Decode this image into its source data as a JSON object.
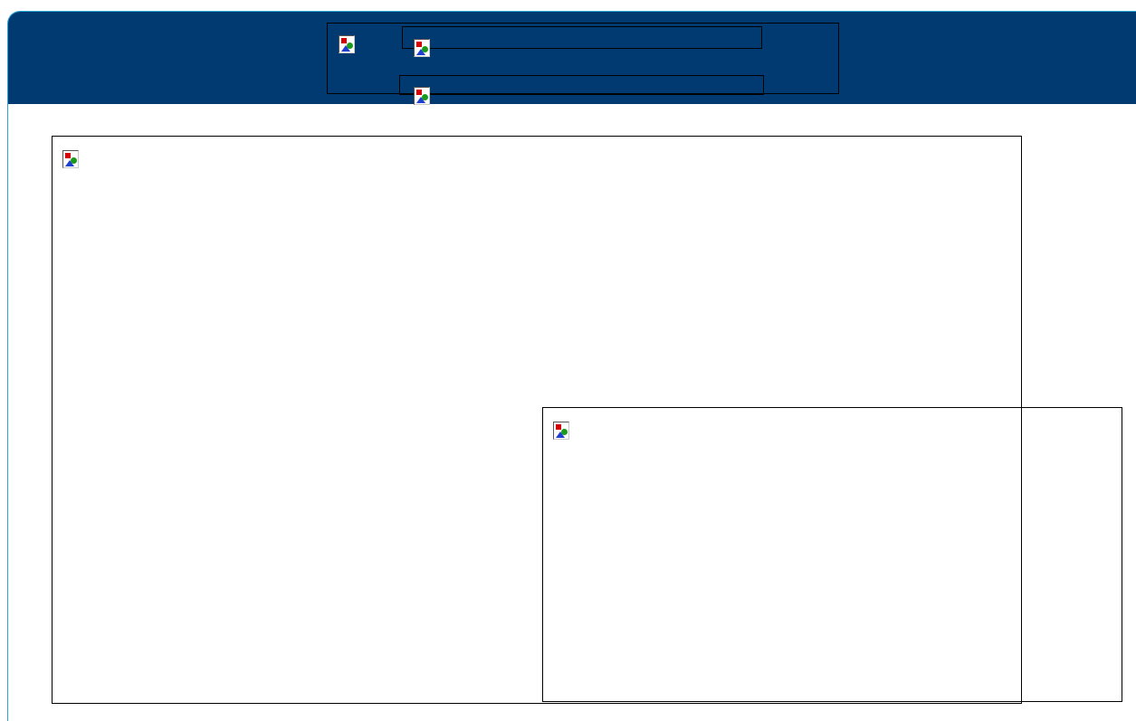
{
  "page": {
    "title": "",
    "colors": {
      "header_bg": "#003a70",
      "frame_border": "#2aa5d8",
      "box_border": "#000000"
    }
  },
  "header": {
    "logo_image": {
      "icon": "broken-image-icon",
      "alt": ""
    },
    "nav_bar_top": {
      "icon": "broken-image-icon",
      "alt": ""
    },
    "nav_bar_bottom": {
      "icon": "broken-image-icon",
      "alt": ""
    }
  },
  "main": {
    "content_image": {
      "icon": "broken-image-icon",
      "alt": ""
    },
    "overlay_image": {
      "icon": "broken-image-icon",
      "alt": ""
    }
  }
}
